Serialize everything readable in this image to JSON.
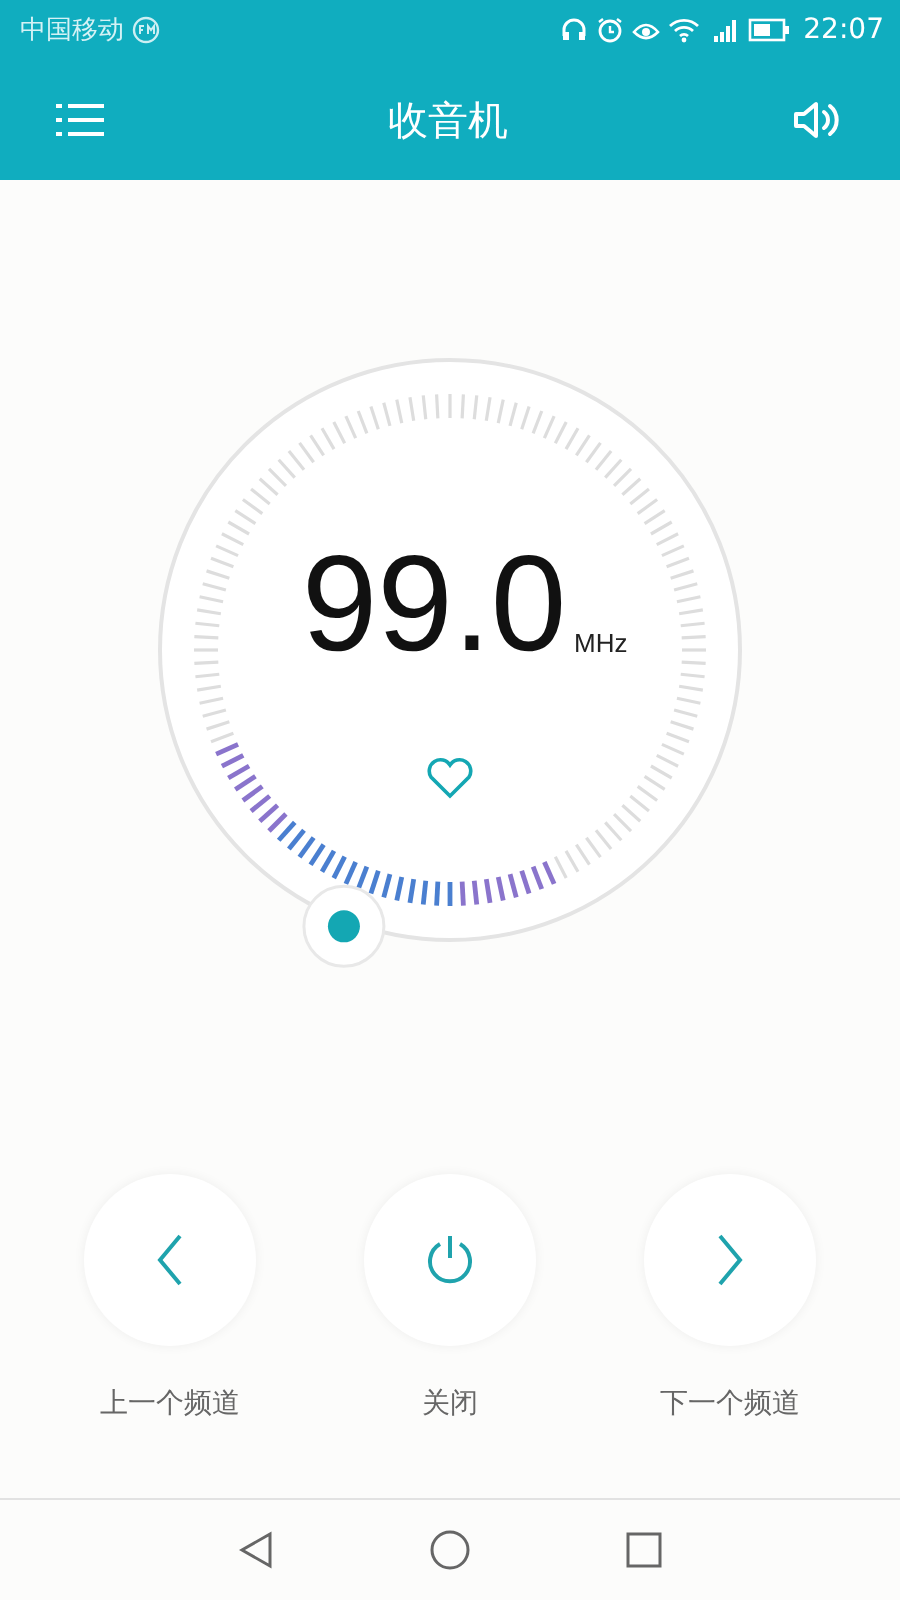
{
  "status_bar": {
    "carrier": "中国移动",
    "time": "22:07"
  },
  "app_bar": {
    "title": "收音机"
  },
  "tuner": {
    "frequency": "99.0",
    "unit": "MHz",
    "favorite": false
  },
  "controls": [
    {
      "kind": "prev",
      "label": "上一个频道"
    },
    {
      "kind": "power",
      "label": "关闭"
    },
    {
      "kind": "next",
      "label": "下一个频道"
    }
  ]
}
